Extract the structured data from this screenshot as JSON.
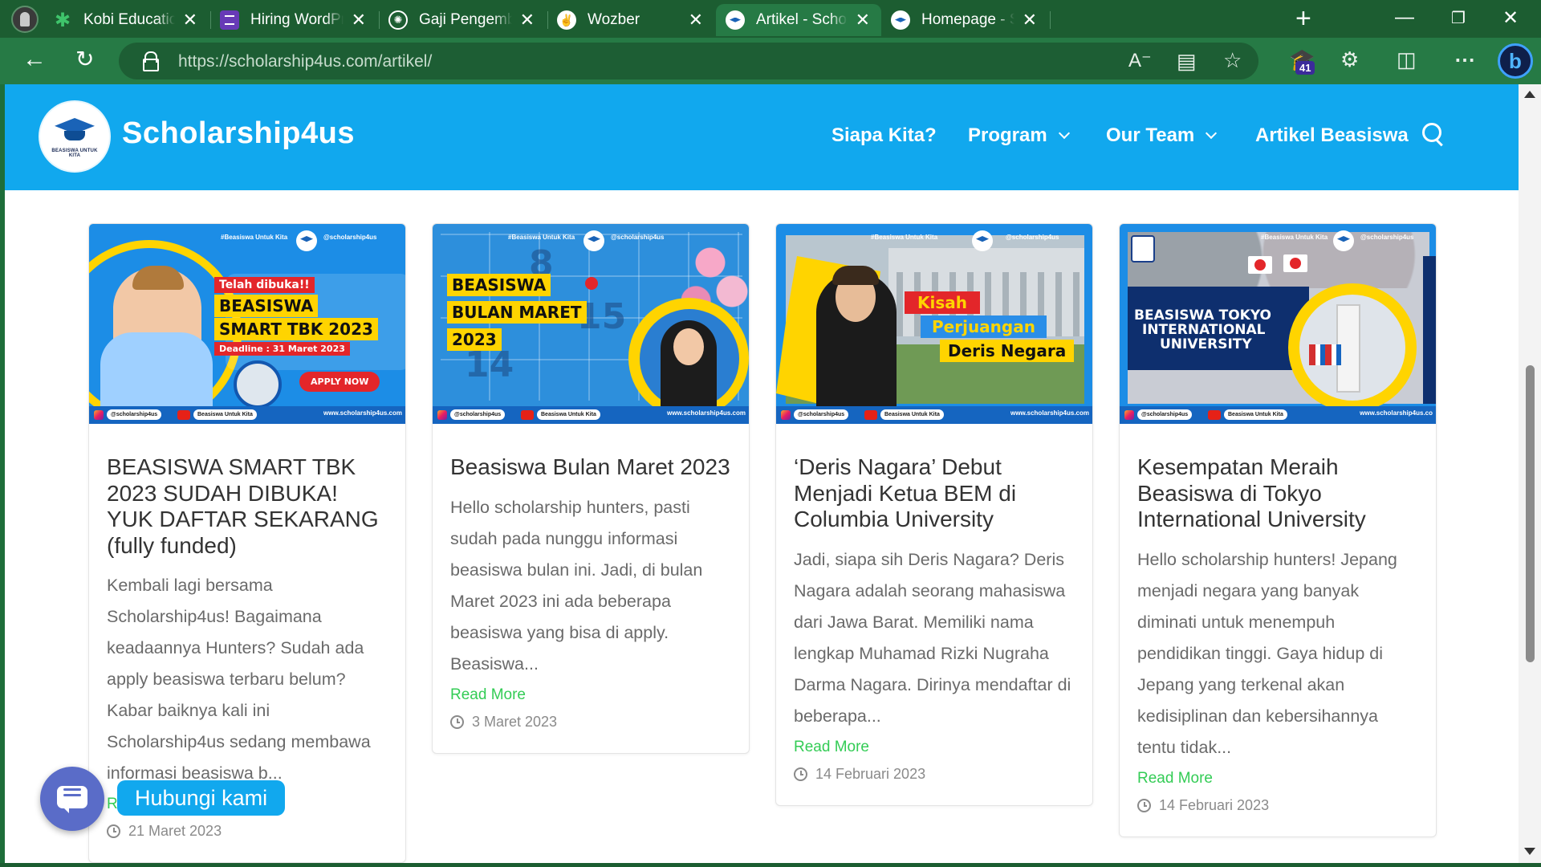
{
  "browser": {
    "tabs": [
      {
        "title": "Kobi Education Care",
        "icon": "kobi-star-icon"
      },
      {
        "title": "Hiring WordPress De",
        "icon": "forms-icon"
      },
      {
        "title": "Gaji Pengembang W",
        "icon": "chatgpt-icon"
      },
      {
        "title": "Wozber",
        "icon": "wozber-icon"
      },
      {
        "title": "Artikel - Scholarship",
        "icon": "scholarship4us-icon",
        "active": true
      },
      {
        "title": "Homepage - Schola",
        "icon": "scholarship4us-icon"
      }
    ],
    "url_domain": "https://scholarship4us.com",
    "url_path": "/artikel/",
    "extensions_badge": "41",
    "colors": {
      "frame": "#1c5d31",
      "toolbar": "#267a45"
    }
  },
  "site": {
    "title": "Scholarship4us",
    "logo_text": "BEASISWA UNTUK KITA",
    "nav": [
      {
        "label": "Siapa Kita?",
        "dropdown": false
      },
      {
        "label": "Program",
        "dropdown": true
      },
      {
        "label": "Our Team",
        "dropdown": true
      },
      {
        "label": "Artikel Beasiswa",
        "dropdown": false
      }
    ],
    "brand_color": "#11a8ee",
    "accent_green": "#33cc55"
  },
  "thumb_common": {
    "hashtag": "#Beasiswa Untuk Kita",
    "handle": "@scholarship4us",
    "ig": "@scholarship4us",
    "yt": "Beasiswa Untuk Kita",
    "site": "www.scholarship4us.com"
  },
  "articles": [
    {
      "title": "BEASISWA SMART TBK 2023 SUDAH DIBUKA! YUK DAFTAR SEKARANG (fully funded)",
      "excerpt": "Kembali lagi bersama Scholarship4us! Bagaimana keadaannya Hunters? Sudah ada apply beasiswa terbaru belum? Kabar baiknya kali ini Scholarship4us sedang membawa informasi beasiswa b...",
      "read_more": "Read More",
      "date": "21 Maret 2023",
      "thumb": {
        "line1": "Telah dibuka!!",
        "line2": "BEASISWA",
        "line3": "SMART TBK 2023",
        "line4": "Deadline : 31 Maret 2023",
        "cta": "APPLY NOW"
      }
    },
    {
      "title": "Beasiswa Bulan Maret 2023",
      "excerpt": "Hello scholarship hunters, pasti sudah pada nunggu informasi beasiswa bulan ini. Jadi, di bulan Maret 2023 ini ada beberapa beasiswa yang bisa di apply. Beasiswa...",
      "read_more": "Read More",
      "date": "3 Maret 2023",
      "thumb": {
        "line1": "BEASISWA",
        "line2": "BULAN MARET",
        "line3": "2023"
      }
    },
    {
      "title": "‘Deris Nagara’ Debut Menjadi Ketua BEM di Columbia University",
      "excerpt": "Jadi, siapa sih Deris Nagara? Deris Nagara adalah seorang mahasiswa dari Jawa Barat. Memiliki nama lengkap Muhamad Rizki Nugraha Darma Nagara. Dirinya mendaftar di beberapa...",
      "read_more": "Read More",
      "date": "14 Februari 2023",
      "thumb": {
        "line1": "Kisah",
        "line2": "Perjuangan",
        "line3": "Deris Negara"
      }
    },
    {
      "title": "Kesempatan Meraih Beasiswa di Tokyo International University",
      "excerpt": "Hello scholarship hunters! Jepang menjadi negara yang banyak diminati untuk menempuh pendidikan tinggi. Gaya hidup di Jepang yang terkenal akan kedisiplinan dan kebersihannya tentu tidak...",
      "read_more": "Read More",
      "date": "14 Februari 2023",
      "thumb": {
        "line1": "BEASISWA TOKYO",
        "line2": "INTERNATIONAL",
        "line3": "UNIVERSITY",
        "site": "www.scholarship4us.co"
      }
    }
  ],
  "chat": {
    "label": "Hubungi kami"
  }
}
